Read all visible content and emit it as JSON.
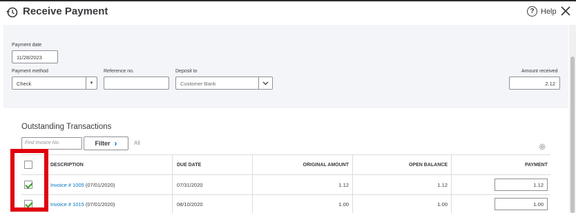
{
  "header": {
    "title": "Receive Payment",
    "help_label": "Help",
    "help_glyph": "?"
  },
  "form": {
    "payment_date_label": "Payment date",
    "payment_date_value": "11/28/2023",
    "payment_method_label": "Payment method",
    "payment_method_value": "Check",
    "reference_label": "Reference no.",
    "reference_value": "",
    "deposit_to_label": "Deposit to",
    "deposit_to_value": "Customer Bank",
    "amount_received_label": "Amount received",
    "amount_received_value": "2.12"
  },
  "transactions": {
    "section_title": "Outstanding Transactions",
    "find_placeholder": "Find Invoice No.",
    "filter_label": "Filter",
    "filter_chevron": "›",
    "all_label": "All",
    "columns": {
      "description": "DESCRIPTION",
      "due_date": "DUE DATE",
      "original_amount": "ORIGINAL AMOUNT",
      "open_balance": "OPEN BALANCE",
      "payment": "PAYMENT"
    },
    "rows": [
      {
        "checked": true,
        "invoice_link": "Invoice # 1005",
        "invoice_date": " (07/01/2020)",
        "due_date": "07/31/2020",
        "original_amount": "1.12",
        "open_balance": "1.12",
        "payment": "1.12"
      },
      {
        "checked": true,
        "invoice_link": "Invoice # 1015",
        "invoice_date": " (07/01/2020)",
        "due_date": "08/10/2020",
        "original_amount": "1.00",
        "open_balance": "1.00",
        "payment": "1.00"
      }
    ]
  },
  "colors": {
    "accent_link": "#0077c5",
    "check_green": "#2ca01c",
    "highlight_red": "#e0000d",
    "form_background": "#f4f5f8"
  },
  "icons": [
    "history-icon",
    "help-icon",
    "close-icon",
    "chevron-down-icon",
    "gear-icon",
    "checkmark-icon"
  ]
}
